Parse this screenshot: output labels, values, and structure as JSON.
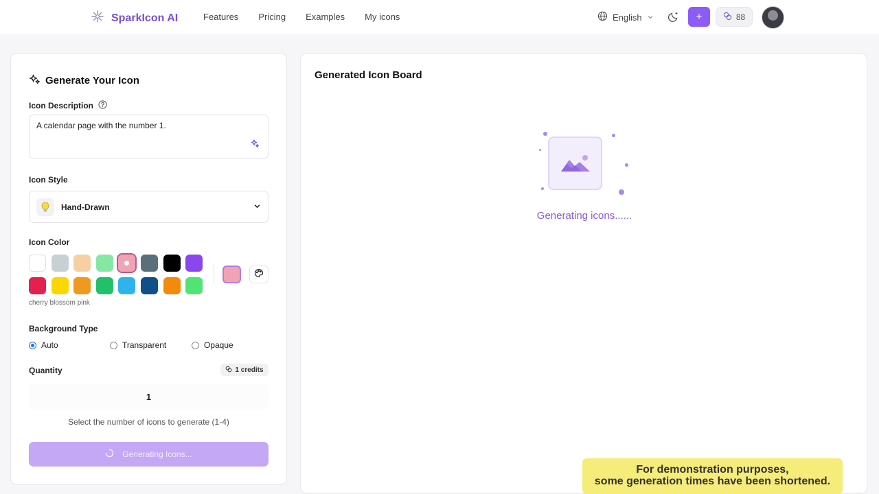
{
  "brand": {
    "name": "SparkIcon AI"
  },
  "nav": {
    "items": [
      "Features",
      "Pricing",
      "Examples",
      "My icons"
    ]
  },
  "header": {
    "language": "English",
    "plus_label": "+",
    "credits": "88"
  },
  "generator": {
    "title": "Generate Your Icon",
    "description_label": "Icon Description",
    "description_value": "A calendar page with the number 1.",
    "style_label": "Icon Style",
    "style_value": "Hand-Drawn",
    "color_label": "Icon Color",
    "colors": [
      "#ffffff",
      "#c8d0d4",
      "#f6cfa3",
      "#86e7a4",
      "#f0a3b5",
      "#5b6f7a",
      "#000000",
      "#8b47ee",
      "#e3204e",
      "#fad700",
      "#ef9a1e",
      "#22c06b",
      "#2fb3ef",
      "#124e87",
      "#f28a0c",
      "#51e475"
    ],
    "selected_color": "#f0a3b5",
    "selected_color_name": "cherry blossom pink",
    "background_label": "Background Type",
    "background_options": [
      "Auto",
      "Transparent",
      "Opaque"
    ],
    "background_selected": "Auto",
    "quantity_label": "Quantity",
    "credits_badge": "1 credits",
    "quantity_value": "1",
    "quantity_help": "Select the number of icons to generate (1-4)",
    "generate_button": "Generating Icons..."
  },
  "board": {
    "title": "Generated Icon Board",
    "status": "Generating icons......"
  },
  "demo_note": {
    "line1": "For demonstration purposes,",
    "line2": "some generation times have been shortened."
  }
}
